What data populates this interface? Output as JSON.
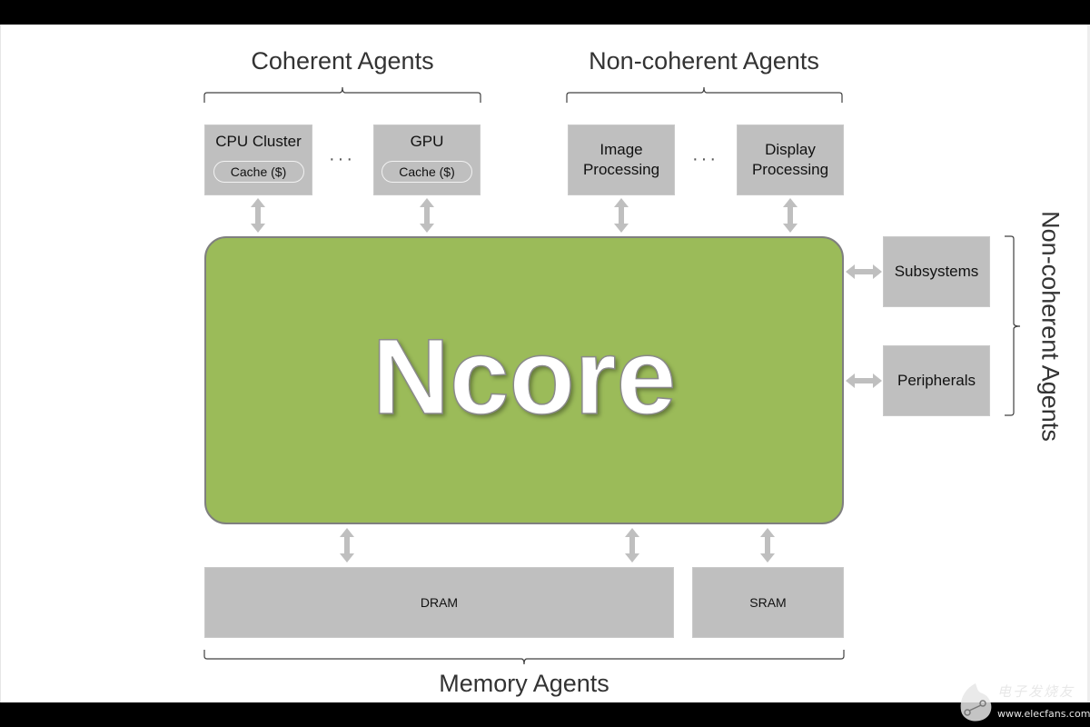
{
  "diagram": {
    "core": {
      "label": "Ncore",
      "color": "#9bbb59"
    },
    "groups": {
      "coherent": {
        "title": "Coherent Agents"
      },
      "noncoherent_top": {
        "title": "Non-coherent Agents"
      },
      "noncoherent_side": {
        "title": "Non-coherent Agents"
      },
      "memory": {
        "title": "Memory Agents"
      }
    },
    "coherent_agents": [
      {
        "label": "CPU Cluster",
        "cache": "Cache ($)"
      },
      {
        "label": "GPU",
        "cache": "Cache ($)"
      }
    ],
    "noncoherent_agents": [
      {
        "label_line1": "Image",
        "label_line2": "Processing"
      },
      {
        "label_line1": "Display",
        "label_line2": "Processing"
      }
    ],
    "side_agents": [
      {
        "label": "Subsystems"
      },
      {
        "label": "Peripherals"
      }
    ],
    "memory_agents": [
      {
        "label": "DRAM"
      },
      {
        "label": "SRAM"
      }
    ],
    "ellipsis": "···",
    "connections": [
      {
        "from": "CPU Cluster",
        "to": "Ncore",
        "type": "bidirectional"
      },
      {
        "from": "GPU",
        "to": "Ncore",
        "type": "bidirectional"
      },
      {
        "from": "Image Processing",
        "to": "Ncore",
        "type": "bidirectional"
      },
      {
        "from": "Display Processing",
        "to": "Ncore",
        "type": "bidirectional"
      },
      {
        "from": "Subsystems",
        "to": "Ncore",
        "type": "bidirectional"
      },
      {
        "from": "Peripherals",
        "to": "Ncore",
        "type": "bidirectional"
      },
      {
        "from": "DRAM",
        "to": "Ncore",
        "type": "bidirectional"
      },
      {
        "from": "DRAM",
        "to": "Ncore",
        "type": "bidirectional"
      },
      {
        "from": "SRAM",
        "to": "Ncore",
        "type": "bidirectional"
      }
    ]
  },
  "watermark": {
    "cn": "电子发烧友",
    "url": "www.elecfans.com"
  }
}
